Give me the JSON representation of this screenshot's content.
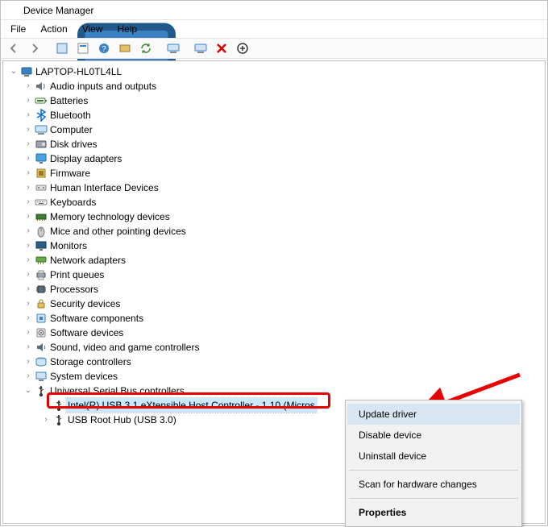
{
  "title": "Device Manager",
  "menubar": {
    "file": "File",
    "action": "Action",
    "view": "View",
    "help": "Help"
  },
  "computer_name": "LAPTOP-HL0TL4LL",
  "categories": [
    {
      "name": "Audio inputs and outputs",
      "icon": "speaker"
    },
    {
      "name": "Batteries",
      "icon": "battery"
    },
    {
      "name": "Bluetooth",
      "icon": "bluetooth"
    },
    {
      "name": "Computer",
      "icon": "computer"
    },
    {
      "name": "Disk drives",
      "icon": "disk"
    },
    {
      "name": "Display adapters",
      "icon": "display"
    },
    {
      "name": "Firmware",
      "icon": "firmware"
    },
    {
      "name": "Human Interface Devices",
      "icon": "hid"
    },
    {
      "name": "Keyboards",
      "icon": "keyboard"
    },
    {
      "name": "Memory technology devices",
      "icon": "memory"
    },
    {
      "name": "Mice and other pointing devices",
      "icon": "mouse"
    },
    {
      "name": "Monitors",
      "icon": "monitor"
    },
    {
      "name": "Network adapters",
      "icon": "network"
    },
    {
      "name": "Print queues",
      "icon": "printer"
    },
    {
      "name": "Processors",
      "icon": "cpu"
    },
    {
      "name": "Security devices",
      "icon": "security"
    },
    {
      "name": "Software components",
      "icon": "sw-comp"
    },
    {
      "name": "Software devices",
      "icon": "sw-dev"
    },
    {
      "name": "Sound, video and game controllers",
      "icon": "sound"
    },
    {
      "name": "Storage controllers",
      "icon": "storage"
    },
    {
      "name": "System devices",
      "icon": "system"
    }
  ],
  "usb_category": "Universal Serial Bus controllers",
  "usb_children": [
    {
      "name": "Intel(R) USB 3.1 eXtensible Host Controller - 1.10 (Micros",
      "selected": true
    },
    {
      "name": "USB Root Hub (USB 3.0)",
      "selected": false
    }
  ],
  "context_menu": {
    "update": "Update driver",
    "disable": "Disable device",
    "uninstall": "Uninstall device",
    "scan": "Scan for hardware changes",
    "properties": "Properties"
  }
}
